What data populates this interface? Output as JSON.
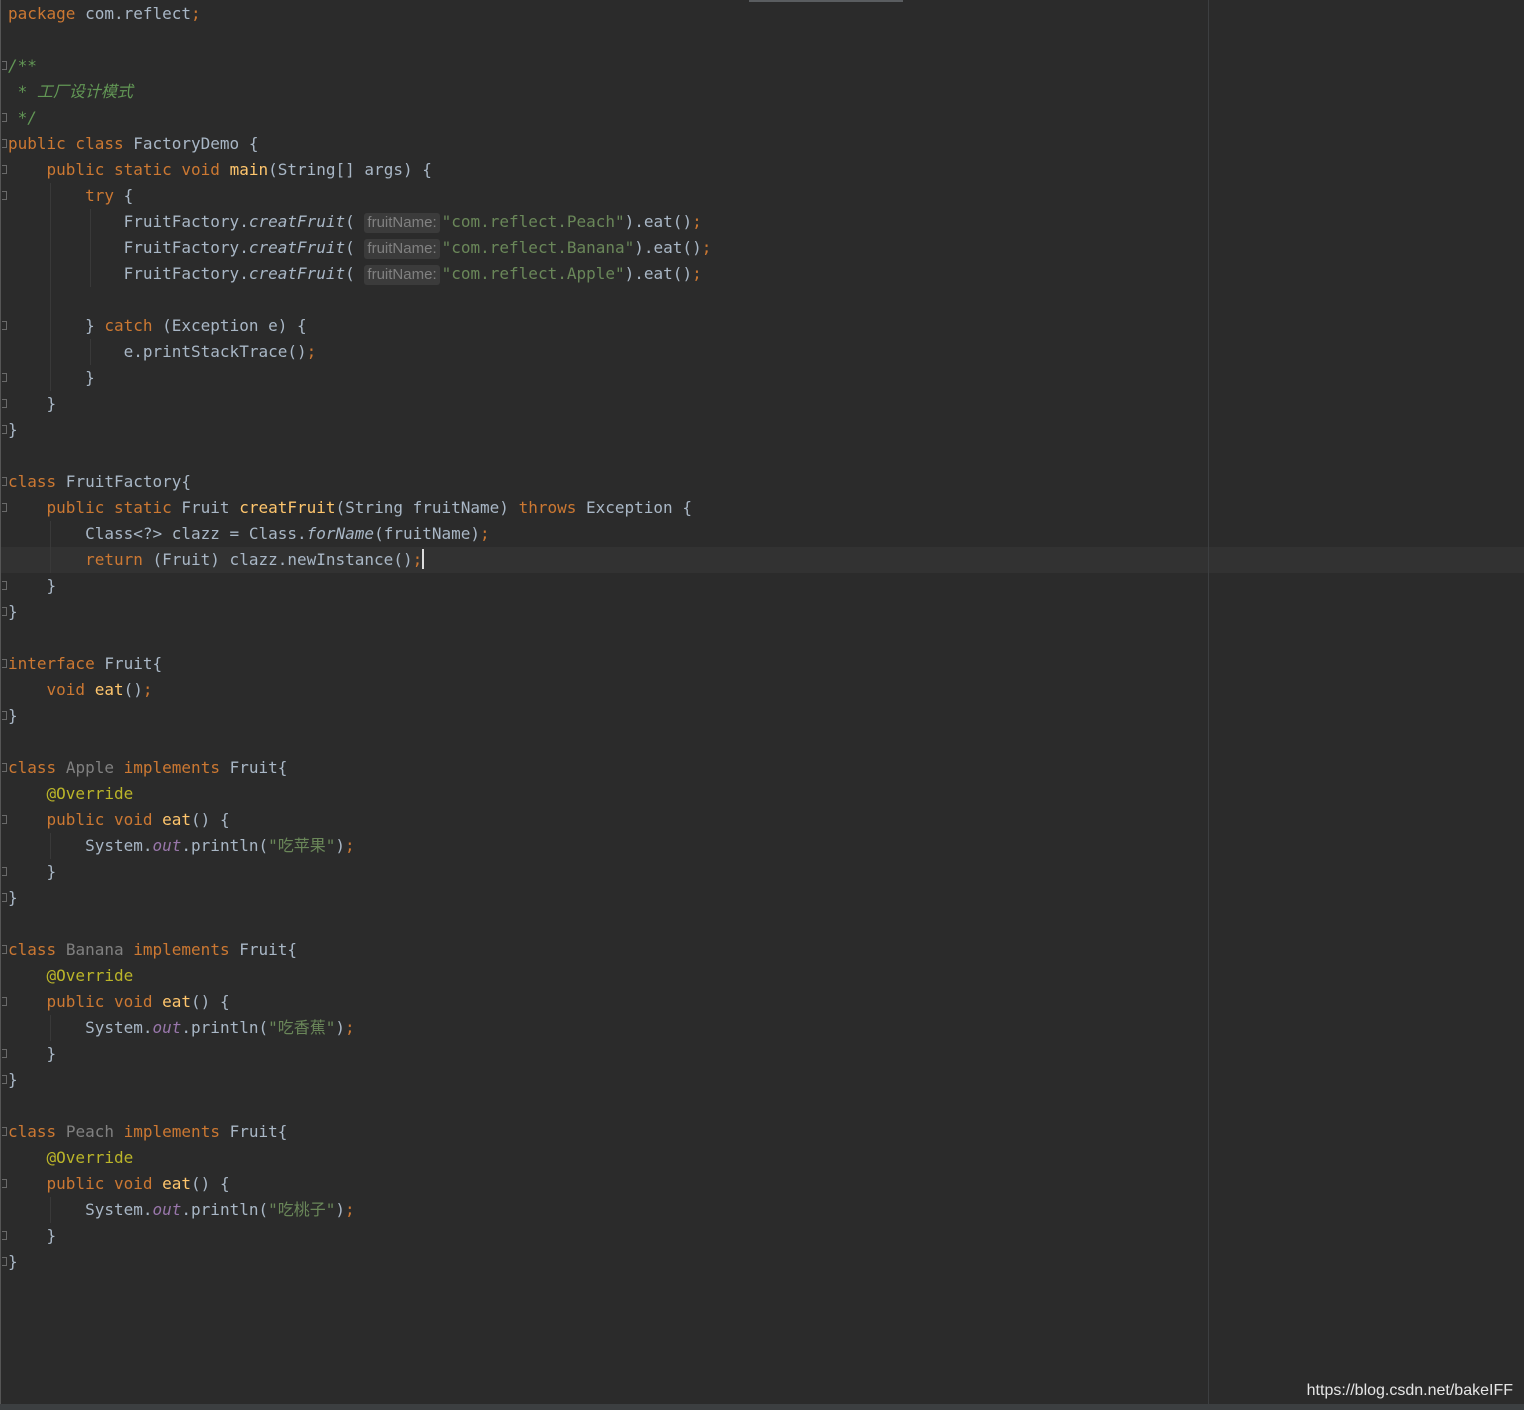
{
  "editor": {
    "language": "java",
    "current_line": 22,
    "caret_visible": true,
    "colors": {
      "background": "#2b2b2b",
      "text": "#a9b7c6",
      "keyword": "#cc7832",
      "string": "#6a8759",
      "comment": "#629755",
      "function_declaration": "#ffc66d",
      "static_field": "#9876aa",
      "annotation": "#bbb529",
      "unused_class": "#808080"
    }
  },
  "lines": [
    [
      {
        "t": "package",
        "c": "kw"
      },
      {
        "t": " com.reflect"
      },
      {
        "t": ";",
        "c": "sc"
      }
    ],
    [],
    [
      {
        "t": "/**",
        "c": "cmt"
      }
    ],
    [
      {
        "t": " * 工厂设计模式",
        "c": "cmt"
      }
    ],
    [
      {
        "t": " */",
        "c": "cmt"
      }
    ],
    [
      {
        "t": "public class",
        "c": "kw"
      },
      {
        "t": " FactoryDemo {"
      }
    ],
    [
      {
        "t": "    "
      },
      {
        "t": "public static void",
        "c": "kw"
      },
      {
        "t": " "
      },
      {
        "t": "main",
        "c": "fn"
      },
      {
        "t": "(String[] args) {"
      }
    ],
    [
      {
        "t": "        "
      },
      {
        "t": "try",
        "c": "kw"
      },
      {
        "t": " {"
      }
    ],
    [
      {
        "t": "            FruitFactory."
      },
      {
        "t": "creatFruit",
        "c": "st"
      },
      {
        "t": "( "
      },
      {
        "h": "fruitName:"
      },
      {
        "t": "\"com.reflect.Peach\"",
        "c": "str"
      },
      {
        "t": ").eat()"
      },
      {
        "t": ";",
        "c": "sc"
      }
    ],
    [
      {
        "t": "            FruitFactory."
      },
      {
        "t": "creatFruit",
        "c": "st"
      },
      {
        "t": "( "
      },
      {
        "h": "fruitName:"
      },
      {
        "t": "\"com.reflect.Banana\"",
        "c": "str"
      },
      {
        "t": ").eat()"
      },
      {
        "t": ";",
        "c": "sc"
      }
    ],
    [
      {
        "t": "            FruitFactory."
      },
      {
        "t": "creatFruit",
        "c": "st"
      },
      {
        "t": "( "
      },
      {
        "h": "fruitName:"
      },
      {
        "t": "\"com.reflect.Apple\"",
        "c": "str"
      },
      {
        "t": ").eat()"
      },
      {
        "t": ";",
        "c": "sc"
      }
    ],
    [],
    [
      {
        "t": "        } "
      },
      {
        "t": "catch",
        "c": "kw"
      },
      {
        "t": " (Exception e) {"
      }
    ],
    [
      {
        "t": "            e.printStackTrace()"
      },
      {
        "t": ";",
        "c": "sc"
      }
    ],
    [
      {
        "t": "        }"
      }
    ],
    [
      {
        "t": "    }"
      }
    ],
    [
      {
        "t": "}"
      }
    ],
    [],
    [
      {
        "t": "class",
        "c": "kw"
      },
      {
        "t": " FruitFactory{"
      }
    ],
    [
      {
        "t": "    "
      },
      {
        "t": "public static",
        "c": "kw"
      },
      {
        "t": " Fruit "
      },
      {
        "t": "creatFruit",
        "c": "fn"
      },
      {
        "t": "(String fruitName) "
      },
      {
        "t": "throws",
        "c": "kw"
      },
      {
        "t": " Exception {"
      }
    ],
    [
      {
        "t": "        Class<?> clazz = Class."
      },
      {
        "t": "forName",
        "c": "st"
      },
      {
        "t": "(fruitName)"
      },
      {
        "t": ";",
        "c": "sc"
      }
    ],
    [
      {
        "t": "        "
      },
      {
        "t": "return",
        "c": "kw"
      },
      {
        "t": " (Fruit) clazz.newInstance()"
      },
      {
        "t": ";",
        "c": "sc"
      },
      {
        "caret": true
      }
    ],
    [
      {
        "t": "    }"
      }
    ],
    [
      {
        "t": "}"
      }
    ],
    [],
    [
      {
        "t": "interface",
        "c": "kw"
      },
      {
        "t": " Fruit{"
      }
    ],
    [
      {
        "t": "    "
      },
      {
        "t": "void",
        "c": "kw"
      },
      {
        "t": " "
      },
      {
        "t": "eat",
        "c": "fn"
      },
      {
        "t": "()"
      },
      {
        "t": ";",
        "c": "sc"
      }
    ],
    [
      {
        "t": "}"
      }
    ],
    [],
    [
      {
        "t": "class",
        "c": "kw"
      },
      {
        "t": " "
      },
      {
        "t": "Apple",
        "c": "unused"
      },
      {
        "t": " "
      },
      {
        "t": "implements",
        "c": "kw"
      },
      {
        "t": " Fruit{"
      }
    ],
    [
      {
        "t": "    "
      },
      {
        "t": "@Override",
        "c": "ann"
      }
    ],
    [
      {
        "t": "    "
      },
      {
        "t": "public void",
        "c": "kw"
      },
      {
        "t": " "
      },
      {
        "t": "eat",
        "c": "fn"
      },
      {
        "t": "() {"
      }
    ],
    [
      {
        "t": "        System."
      },
      {
        "t": "out",
        "c": "fld"
      },
      {
        "t": ".println("
      },
      {
        "t": "\"吃苹果\"",
        "c": "str"
      },
      {
        "t": ")"
      },
      {
        "t": ";",
        "c": "sc"
      }
    ],
    [
      {
        "t": "    }"
      }
    ],
    [
      {
        "t": "}"
      }
    ],
    [],
    [
      {
        "t": "class",
        "c": "kw"
      },
      {
        "t": " "
      },
      {
        "t": "Banana",
        "c": "unused"
      },
      {
        "t": " "
      },
      {
        "t": "implements",
        "c": "kw"
      },
      {
        "t": " Fruit{"
      }
    ],
    [
      {
        "t": "    "
      },
      {
        "t": "@Override",
        "c": "ann"
      }
    ],
    [
      {
        "t": "    "
      },
      {
        "t": "public void",
        "c": "kw"
      },
      {
        "t": " "
      },
      {
        "t": "eat",
        "c": "fn"
      },
      {
        "t": "() {"
      }
    ],
    [
      {
        "t": "        System."
      },
      {
        "t": "out",
        "c": "fld"
      },
      {
        "t": ".println("
      },
      {
        "t": "\"吃香蕉\"",
        "c": "str"
      },
      {
        "t": ")"
      },
      {
        "t": ";",
        "c": "sc"
      }
    ],
    [
      {
        "t": "    }"
      }
    ],
    [
      {
        "t": "}"
      }
    ],
    [],
    [
      {
        "t": "class",
        "c": "kw"
      },
      {
        "t": " "
      },
      {
        "t": "Peach",
        "c": "unused"
      },
      {
        "t": " "
      },
      {
        "t": "implements",
        "c": "kw"
      },
      {
        "t": " Fruit{"
      }
    ],
    [
      {
        "t": "    "
      },
      {
        "t": "@Override",
        "c": "ann"
      }
    ],
    [
      {
        "t": "    "
      },
      {
        "t": "public void",
        "c": "kw"
      },
      {
        "t": " "
      },
      {
        "t": "eat",
        "c": "fn"
      },
      {
        "t": "() {"
      }
    ],
    [
      {
        "t": "        System."
      },
      {
        "t": "out",
        "c": "fld"
      },
      {
        "t": ".println("
      },
      {
        "t": "\"吃桃子\"",
        "c": "str"
      },
      {
        "t": ")"
      },
      {
        "t": ";",
        "c": "sc"
      }
    ],
    [
      {
        "t": "    }"
      }
    ],
    [
      {
        "t": "}"
      }
    ]
  ],
  "fold_markers": [
    3,
    5,
    6,
    7,
    8,
    13,
    15,
    16,
    17,
    19,
    20,
    23,
    24,
    26,
    28,
    30,
    32,
    34,
    35,
    37,
    39,
    41,
    42,
    44,
    46,
    48,
    49
  ],
  "watermark": "https://blog.csdn.net/bakeIFF"
}
